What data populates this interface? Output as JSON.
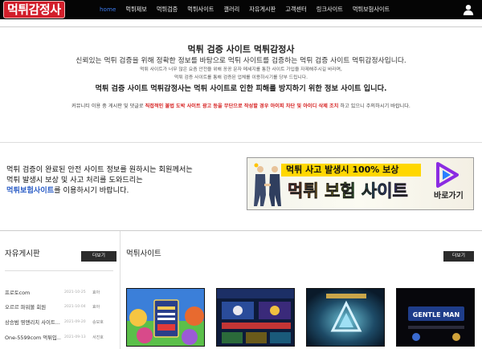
{
  "nav": {
    "logo": "먹튀감정사",
    "items": [
      {
        "label": "home",
        "active": true
      },
      {
        "label": "먹튀제보"
      },
      {
        "label": "먹튀검증"
      },
      {
        "label": "먹튀사이트"
      },
      {
        "label": "갤러리"
      },
      {
        "label": "자유게시판"
      },
      {
        "label": "고객센터"
      },
      {
        "label": "링크사이트"
      },
      {
        "label": "먹튀보험사이트"
      }
    ],
    "user_icon": "user-icon"
  },
  "hero": {
    "title": "먹튀 검증 사이트 먹튀감정사",
    "subtitle": "신뢰있는 먹튀 검증을 위해 정확한 정보를 바탕으로 먹튀 사이트를 검증하는 먹튀 검증 사이트 먹튀감정사입니다.",
    "line1": "먹튀 사이트가 너무 많은 요즘 안전을 위해 꽁꽁 문자 메세지를 통한 사이트 가입을 자제해주시길 바라며,",
    "line2": "먹튀 검증 사이트를 통해 검증된 업체를 이용하시기를 당부 드립니다.",
    "bold": "먹튀 검증 사이트 먹튀감정사는 먹튀 사이트로 인한 피해를 방지하기 위한 정보 사이트 입니다.",
    "notice_pre": "커뮤니티 이용 중 게시판 및 댓글로 ",
    "notice_red": "직접적인 불법 도박 사이트 광고 등을 무단으로 작성할 경우 아이피 차단 및 아이디 삭제 조치",
    "notice_post": " 하고 있으니 주의하시기 바랍니다."
  },
  "promo": {
    "line1": "먹튀 검증이 완료된 안전 사이트 정보를 원하시는 회원께서는",
    "line2": "먹튀 발생시 보상 및 사고 처리를 도와드리는",
    "link": "먹튀보험사이트",
    "line3_post": "를 이용하시기 바랍니다."
  },
  "banner": {
    "top": "먹튀 사고 발생시 100% 보상",
    "main": "먹튀 보험 사이트",
    "go": "바로가기",
    "colors": {
      "highlight": "#ffd700",
      "play_outer": "#8b2be2",
      "play_inner": "#2a80ff"
    }
  },
  "board": {
    "title": "자유게시판",
    "more": "더보기",
    "rows": [
      {
        "title": "프로토com",
        "date": "2021-10-25",
        "author": "효아"
      },
      {
        "title": "오르르 파워볼 회원",
        "date": "2021-10-04",
        "author": "효아"
      },
      {
        "title": "상승범 영앤리치 사이트...",
        "date": "2021-09-20",
        "author": "승모호"
      },
      {
        "title": "One-5599com 먹튀입...",
        "date": "2021-09-13",
        "author": "서진호"
      }
    ]
  },
  "sites": {
    "title": "먹튀사이트",
    "more": "더보기",
    "thumbs": [
      {
        "name": "game-thumbnail-1"
      },
      {
        "name": "game-thumbnail-2"
      },
      {
        "name": "game-thumbnail-3"
      },
      {
        "name": "game-thumbnail-4",
        "text": "GENTLE MAN"
      }
    ]
  }
}
